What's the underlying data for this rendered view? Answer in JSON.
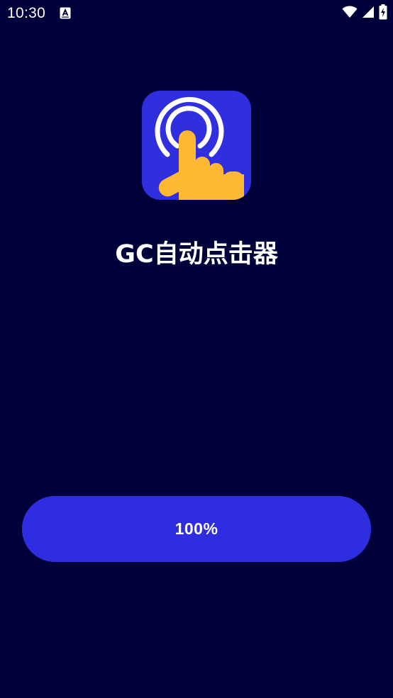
{
  "status_bar": {
    "time": "10:30",
    "notification_icon": "app-notification-icon",
    "icons": [
      "wifi-icon",
      "signal-icon",
      "battery-charging-icon"
    ]
  },
  "app": {
    "name": "GC自动点击器",
    "icon": "tap-hand-icon",
    "icon_bg_color": "#2f2fe0",
    "hand_color": "#ffb833"
  },
  "progress": {
    "label": "100%",
    "value": 1.0
  },
  "colors": {
    "background": "#00003a",
    "button": "#2e2ee0",
    "text": "#ffffff"
  }
}
